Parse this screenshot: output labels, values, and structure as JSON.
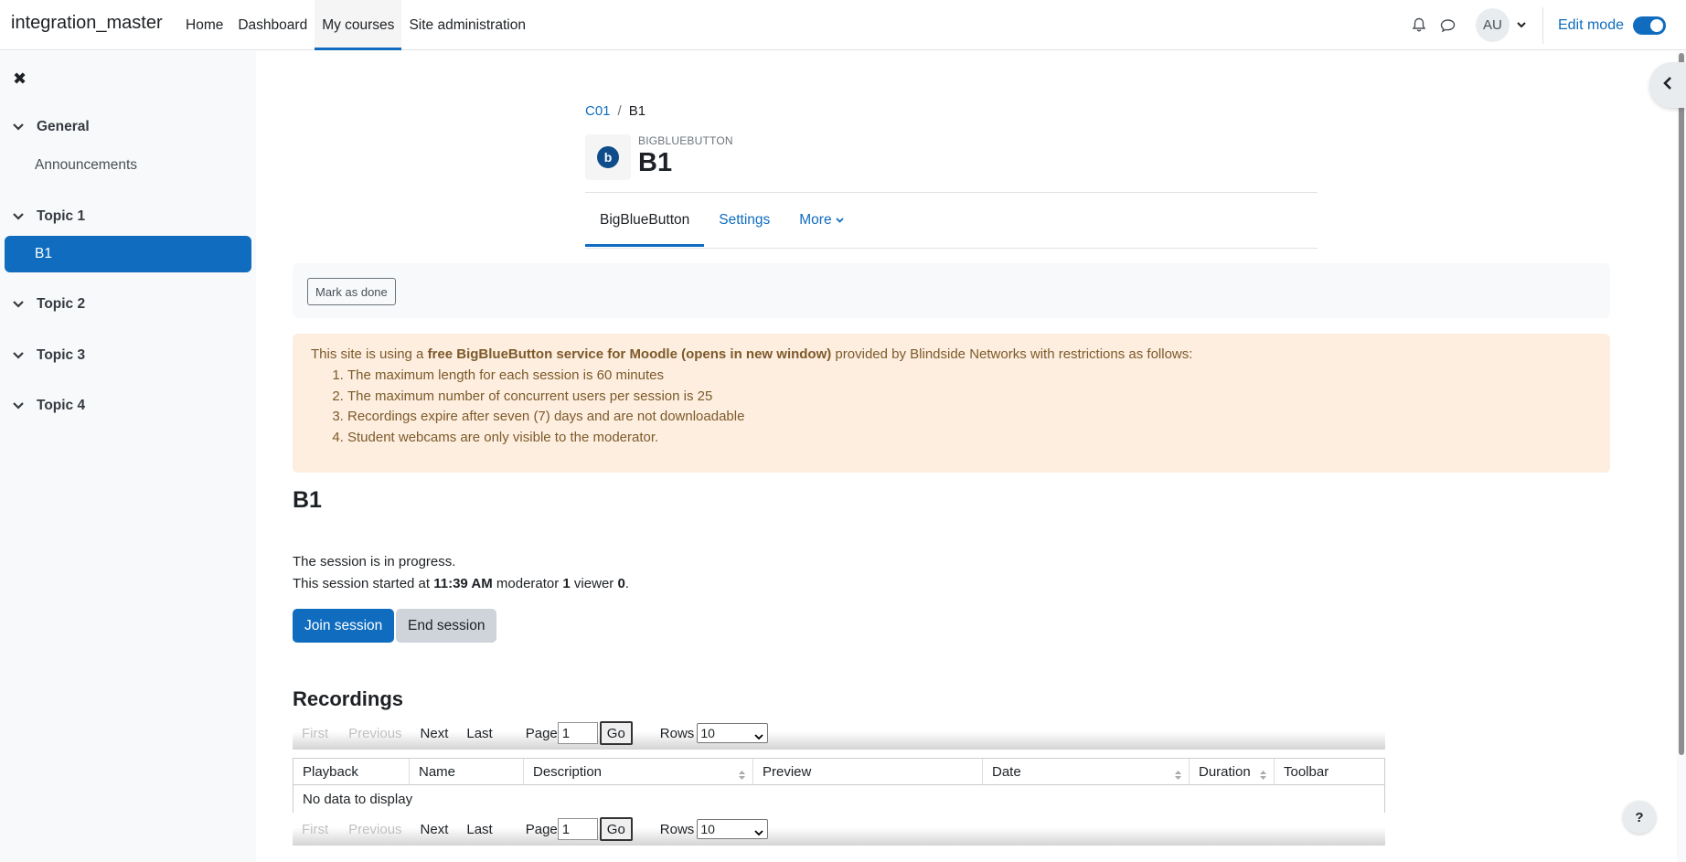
{
  "navbar": {
    "brand": "integration_master",
    "links": [
      "Home",
      "Dashboard",
      "My courses",
      "Site administration"
    ],
    "active_link": "My courses",
    "user_initials": "AU",
    "edit_mode_label": "Edit mode"
  },
  "drawer": {
    "sections": [
      {
        "title": "General",
        "items": [
          "Announcements"
        ]
      },
      {
        "title": "Topic 1",
        "items": [
          "B1"
        ]
      },
      {
        "title": "Topic 2",
        "items": []
      },
      {
        "title": "Topic 3",
        "items": []
      },
      {
        "title": "Topic 4",
        "items": []
      }
    ],
    "active_item": "B1"
  },
  "header": {
    "breadcrumb": [
      "C01",
      "B1"
    ],
    "module_type": "BIGBLUEBUTTON",
    "icon_letter": "b",
    "title": "B1",
    "tabs": [
      "BigBlueButton",
      "Settings",
      "More"
    ]
  },
  "completion": {
    "mark_done_label": "Mark as done"
  },
  "alert": {
    "intro_prefix": "This site is using a ",
    "intro_bold": "free BigBlueButton service for Moodle (opens in new window)",
    "intro_suffix": " provided by Blindside Networks with restrictions as follows:",
    "items": [
      "The maximum length for each session is 60 minutes",
      "The maximum number of concurrent users per session is 25",
      "Recordings expire after seven (7) days and are not downloadable",
      "Student webcams are only visible to the moderator."
    ]
  },
  "session": {
    "heading": "B1",
    "status": "The session is in progress.",
    "started_prefix": "This session started at ",
    "started_time": "11:39 AM",
    "moderator_label": " moderator ",
    "moderator_count": "1",
    "viewer_label": " viewer ",
    "viewer_count": "0",
    "period": ".",
    "join_label": "Join session",
    "end_label": "End session"
  },
  "recordings": {
    "heading": "Recordings",
    "pager": {
      "first": "First",
      "previous": "Previous",
      "next": "Next",
      "last": "Last",
      "page_label": "Page",
      "page_value": "1",
      "go_label": "Go",
      "rows_label": "Rows",
      "rows_value": "10"
    },
    "columns": [
      "Playback",
      "Name",
      "Description",
      "Preview",
      "Date",
      "Duration",
      "Toolbar"
    ],
    "empty_text": "No data to display"
  },
  "help": {
    "label": "?"
  },
  "colors": {
    "accent": "#0f6cbf",
    "alert_bg": "#fdeee0",
    "alert_text": "#7d5a29"
  }
}
